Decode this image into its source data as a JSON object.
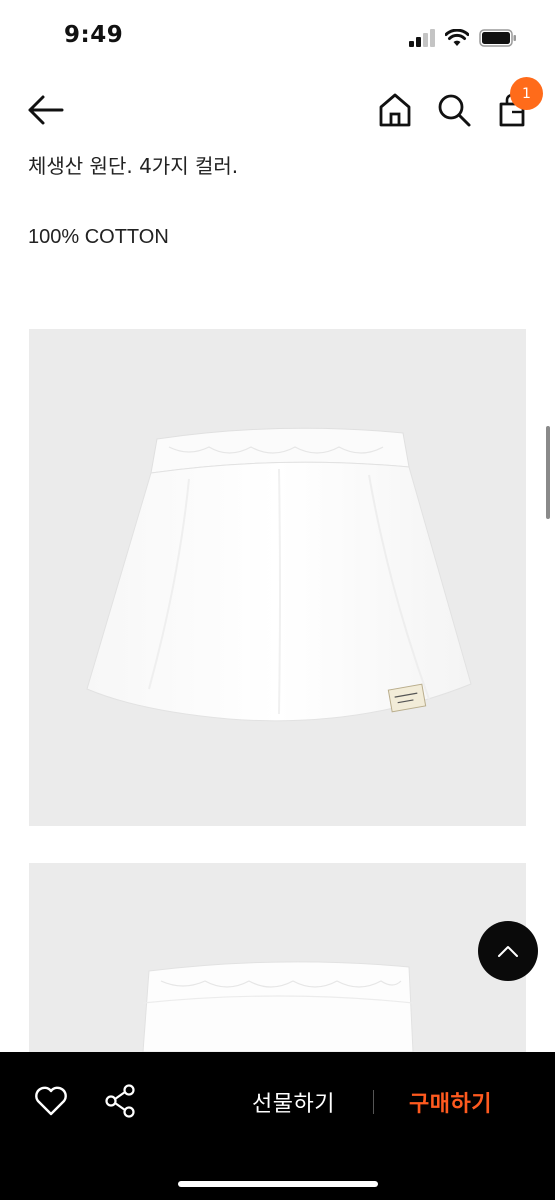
{
  "status_bar": {
    "time": "9:49",
    "icons": [
      "signal-icon",
      "wifi-icon",
      "battery-icon"
    ]
  },
  "nav": {
    "icons": [
      "back-arrow-icon",
      "home-icon",
      "search-icon",
      "shopping-bag-icon"
    ],
    "cart_count": "1",
    "badge_color": "#ff6b1a"
  },
  "description": {
    "line1": "체생산 원단. 4가지 컬러.",
    "line2": "100% COTTON"
  },
  "product_images": [
    {
      "subject": "white cotton mini skirt",
      "label_text": "SLOWRY"
    },
    {
      "subject": "white cotton mini skirt (partial)"
    }
  ],
  "bottom_bar": {
    "icons": [
      "heart-icon",
      "share-icon"
    ],
    "gift_label": "선물하기",
    "buy_label": "구매하기",
    "buy_color": "#ff5a1f"
  }
}
